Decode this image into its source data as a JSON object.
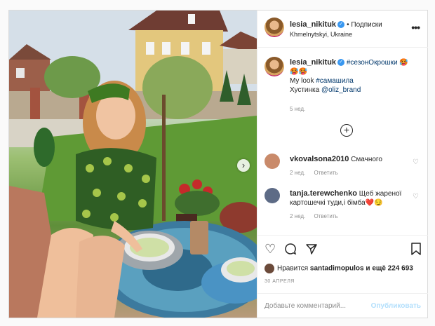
{
  "post": {
    "username": "lesia_nikituk",
    "verified_icon": "verified-badge-icon",
    "follow_label": "• Подписки",
    "location": "Khmelnytskyi, Ukraine",
    "more_icon": "more-options-icon"
  },
  "caption": {
    "username": "lesia_nikituk",
    "hashtag1": "#сезонОкрошки",
    "emoji1": "🥵",
    "emoji_line": "🥵🥵",
    "line2_text": "My look",
    "hashtag2": "#самашила",
    "line3_text": "Хустинка",
    "mention": "@oliz_brand",
    "time": "5 нед."
  },
  "load_more_icon": "plus-circle-icon",
  "comments": [
    {
      "username": "vkovalsona2010",
      "text": "Смачного",
      "time": "2 нед.",
      "reply_label": "Ответить"
    },
    {
      "username": "tanja.terewchenko",
      "text": "Щеб жареної картошечкі туди,і бімба❤️😏",
      "time": "2 нед.",
      "reply_label": "Ответить"
    }
  ],
  "actions": {
    "like_icon": "heart-icon",
    "comment_icon": "comment-icon",
    "share_icon": "paper-plane-icon",
    "save_icon": "bookmark-icon"
  },
  "likes": {
    "prefix": "Нравится",
    "user": "santadimopulos",
    "middle": "и ещё",
    "count": "224 693"
  },
  "date": "30 АПРЕЛЯ",
  "add_comment": {
    "placeholder": "Добавьте комментарий...",
    "publish_label": "Опубликовать"
  },
  "colors": {
    "link": "#00376b",
    "verified": "#3897f0",
    "publish_disabled": "#b2dffc",
    "muted": "#8e8e8e"
  }
}
